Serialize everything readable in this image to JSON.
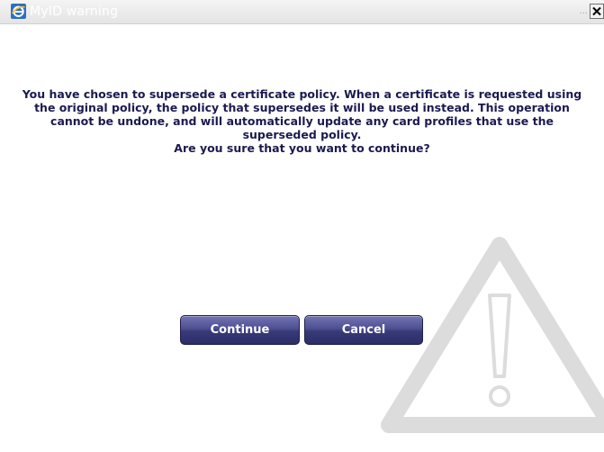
{
  "window": {
    "title": "MyID warning",
    "title_dots": "...",
    "browser_icon": "ie-icon",
    "close_icon": "close-icon"
  },
  "dialog": {
    "message": "You have chosen to supersede a certificate policy. When a certificate is requested using the original policy, the policy that supersedes it will be used instead. This operation cannot be undone, and will automatically update any card profiles that use the superseded policy.",
    "question": "Are you sure that you want to continue?",
    "continue_label": "Continue",
    "cancel_label": "Cancel",
    "watermark_icon": "warning-triangle-icon"
  },
  "colors": {
    "message_text": "#1a1a50",
    "button_bg": "#3f4185",
    "button_text": "#ffffff",
    "watermark": "#dddddd"
  }
}
